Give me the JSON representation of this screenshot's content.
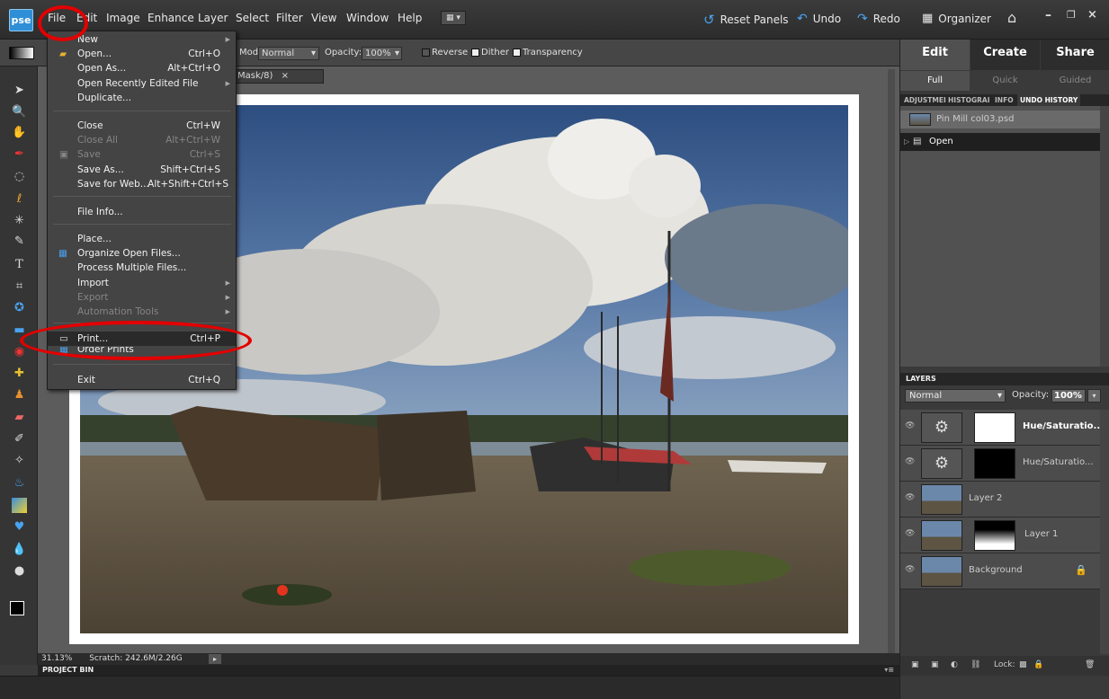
{
  "app": {
    "logo": "pse"
  },
  "menubar": {
    "items": [
      "File",
      "Edit",
      "Image",
      "Enhance",
      "Layer",
      "Select",
      "Filter",
      "View",
      "Window",
      "Help"
    ],
    "reset_panels": "Reset Panels",
    "undo": "Undo",
    "redo": "Redo",
    "organizer": "Organizer"
  },
  "options": {
    "mode_label": "Mode:",
    "mode_value": "Normal",
    "opacity_label": "Opacity:",
    "opacity_value": "100%",
    "reverse": "Reverse",
    "dither": "Dither",
    "transparency": "Transparency"
  },
  "document": {
    "tab_label": "Mask/8)",
    "zoom": "31.13%",
    "scratch": "Scratch: 242.6M/2.26G"
  },
  "project_bin": "PROJECT BIN",
  "file_menu": {
    "items": [
      {
        "label": "New",
        "shortcut": "",
        "submenu": true,
        "enabled": true
      },
      {
        "label": "Open...",
        "shortcut": "Ctrl+O",
        "submenu": false,
        "enabled": true
      },
      {
        "label": "Open As...",
        "shortcut": "Alt+Ctrl+O",
        "submenu": false,
        "enabled": true
      },
      {
        "label": "Open Recently Edited File",
        "shortcut": "",
        "submenu": true,
        "enabled": true
      },
      {
        "label": "Duplicate...",
        "shortcut": "",
        "submenu": false,
        "enabled": true
      },
      {
        "label": "Close",
        "shortcut": "Ctrl+W",
        "submenu": false,
        "enabled": true
      },
      {
        "label": "Close All",
        "shortcut": "Alt+Ctrl+W",
        "submenu": false,
        "enabled": false
      },
      {
        "label": "Save",
        "shortcut": "Ctrl+S",
        "submenu": false,
        "enabled": false
      },
      {
        "label": "Save As...",
        "shortcut": "Shift+Ctrl+S",
        "submenu": false,
        "enabled": true
      },
      {
        "label": "Save for Web...",
        "shortcut": "Alt+Shift+Ctrl+S",
        "submenu": false,
        "enabled": true
      },
      {
        "label": "File Info...",
        "shortcut": "",
        "submenu": false,
        "enabled": true
      },
      {
        "label": "Place...",
        "shortcut": "",
        "submenu": false,
        "enabled": true
      },
      {
        "label": "Organize Open Files...",
        "shortcut": "",
        "submenu": false,
        "enabled": true
      },
      {
        "label": "Process Multiple Files...",
        "shortcut": "",
        "submenu": false,
        "enabled": true
      },
      {
        "label": "Import",
        "shortcut": "",
        "submenu": true,
        "enabled": true
      },
      {
        "label": "Export",
        "shortcut": "",
        "submenu": true,
        "enabled": false
      },
      {
        "label": "Automation Tools",
        "shortcut": "",
        "submenu": true,
        "enabled": false
      },
      {
        "label": "Print...",
        "shortcut": "Ctrl+P",
        "submenu": false,
        "enabled": true
      },
      {
        "label": "Order Prints",
        "shortcut": "",
        "submenu": true,
        "enabled": true
      },
      {
        "label": "Exit",
        "shortcut": "Ctrl+Q",
        "submenu": false,
        "enabled": true
      }
    ]
  },
  "right_panel": {
    "tabs": [
      "Edit",
      "Create",
      "Share"
    ],
    "subtabs": [
      "Full",
      "Quick",
      "Guided"
    ],
    "palette_tabs": [
      "ADJUSTMEI",
      "HISTOGRAI",
      "INFO",
      "UNDO HISTORY"
    ],
    "history": [
      "Pin Mill col03.psd",
      "Open"
    ],
    "layers_title": "LAYERS",
    "blend_mode": "Normal",
    "opacity_label": "Opacity:",
    "opacity_value": "100%",
    "layers": [
      "Hue/Saturatio...",
      "Hue/Saturatio...",
      "Layer 2",
      "Layer 1",
      "Background"
    ],
    "lock_label": "Lock:"
  },
  "colors": {
    "accent": "#2f8fd6",
    "highlight_circle": "#e20000",
    "panel": "#3a3a3a"
  }
}
